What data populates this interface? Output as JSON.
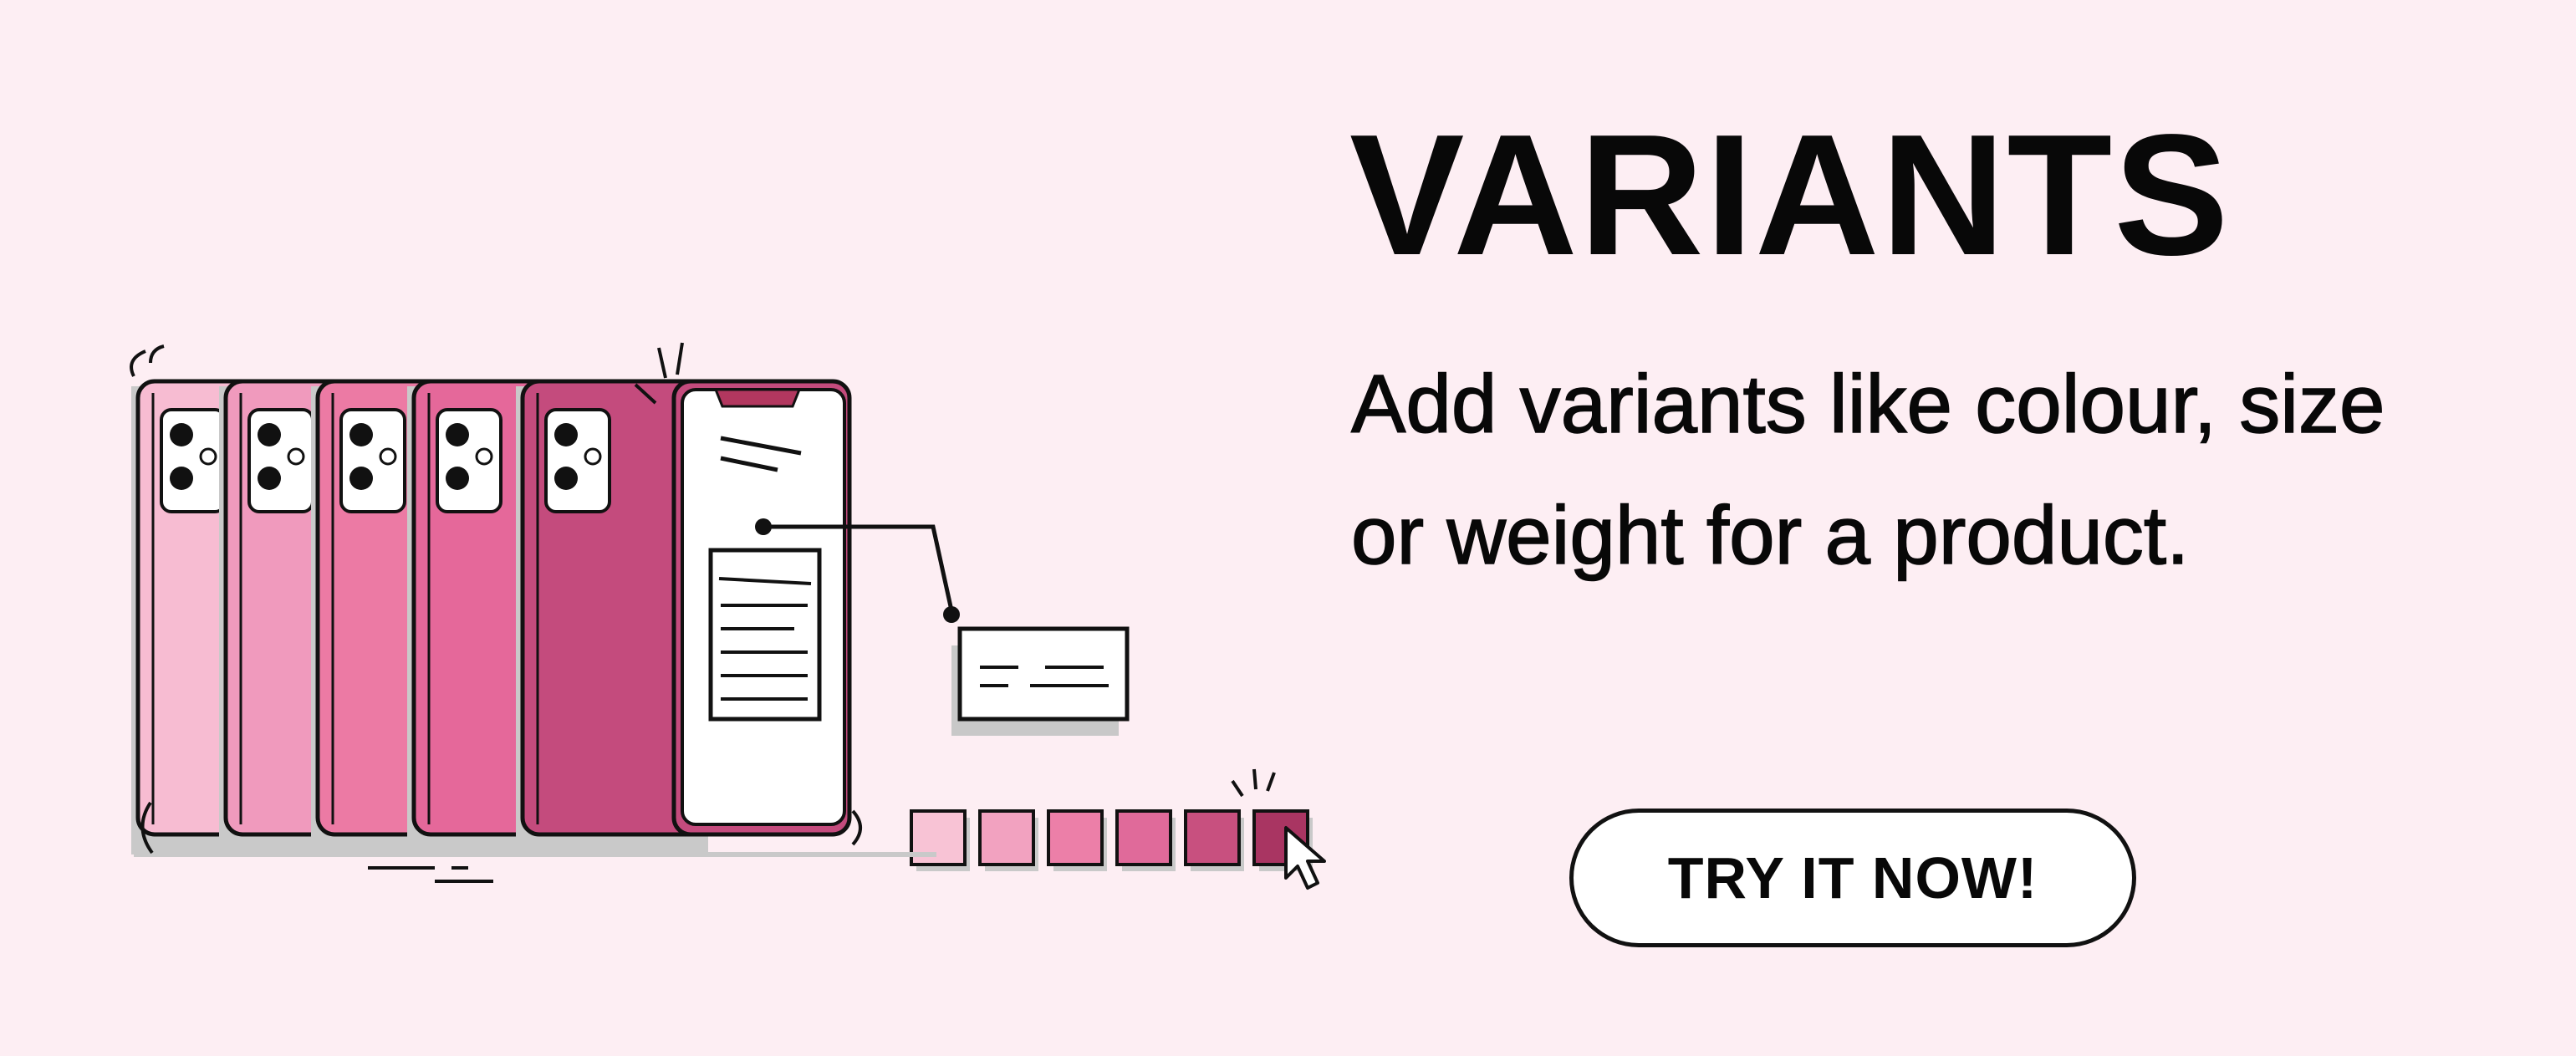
{
  "title": "VARIANTS",
  "description": "Add variants like colour, size or weight for a product.",
  "cta_label": "TRY IT NOW!",
  "illustration": {
    "icon": "phone-variants-illustration",
    "phone_colors": [
      "#f7bcd2",
      "#f09abd",
      "#ec7aa4",
      "#e5689a",
      "#c44b7d"
    ],
    "swatch_colors": [
      "#f8c3d5",
      "#f2a2c0",
      "#ec7fa8",
      "#e06a9a",
      "#c8507f",
      "#a93562"
    ],
    "accent": "#b2375f",
    "background": "#fdeef3"
  }
}
